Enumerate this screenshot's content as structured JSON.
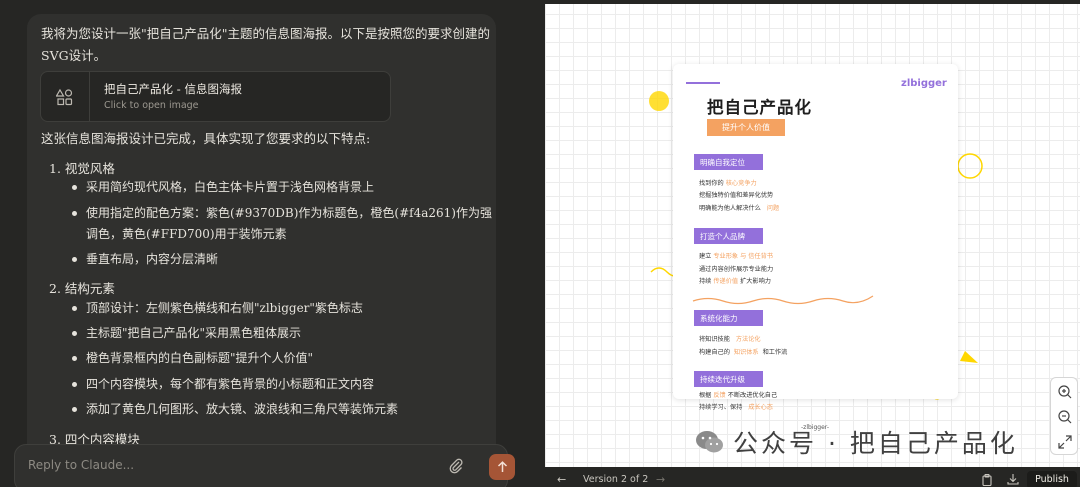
{
  "chat": {
    "intro": "我将为您设计一张\"把自己产品化\"主题的信息图海报。以下是按照您的要求创建的SVG设计。",
    "artifact": {
      "title": "把自己产品化 - 信息图海报",
      "subtitle": "Click to open image",
      "icon": "shapes-icon"
    },
    "summary": "这张信息图海报设计已完成，具体实现了您要求的以下特点:",
    "sections": [
      {
        "heading": "1. 视觉风格",
        "bullets": [
          "采用简约现代风格，白色主体卡片置于浅色网格背景上",
          "使用指定的配色方案：紫色(#9370DB)作为标题色，橙色(#f4a261)作为强调色，黄色(#FFD700)用于装饰元素",
          "垂直布局，内容分层清晰"
        ]
      },
      {
        "heading": "2. 结构元素",
        "bullets": [
          "顶部设计：左侧紫色横线和右侧\"zlbigger\"紫色标志",
          "主标题\"把自己产品化\"采用黑色粗体展示",
          "橙色背景框内的白色副标题\"提升个人价值\"",
          "四个内容模块，每个都有紫色背景的小标题和正文内容",
          "添加了黄色几何图形、放大镜、波浪线和三角尺等装饰元素"
        ]
      },
      {
        "heading": "3. 四个内容模块",
        "bullets": []
      }
    ],
    "reply_placeholder": "Reply to Claude..."
  },
  "preview": {
    "poster": {
      "brand": "zlbigger",
      "title": "把自己产品化",
      "subtitle": "提升个人价值",
      "modules": [
        {
          "heading": "明确自我定位",
          "lines": [
            [
              "找到你的",
              "核心竞争力",
              ""
            ],
            [
              "挖掘独特价值和差异化优势",
              "",
              ""
            ],
            [
              "明确能为他人解决什么",
              "问题",
              ""
            ]
          ]
        },
        {
          "heading": "打造个人品牌",
          "lines": [
            [
              "建立",
              "专业形象",
              "与 信任背书"
            ],
            [
              "通过内容创作展示专业能力",
              "",
              ""
            ],
            [
              "持续",
              "传递价值",
              "扩大影响力"
            ]
          ]
        },
        {
          "heading": "系统化能力",
          "lines": [
            [
              "将知识技能",
              "方法论化",
              ""
            ],
            [
              "构建自己的",
              "知识体系",
              "和工作流"
            ]
          ]
        },
        {
          "heading": "持续迭代升级",
          "lines": [
            [
              "根据",
              "反馈",
              "不断改进优化自己"
            ],
            [
              "持续学习、保持",
              "成长心态",
              ""
            ]
          ]
        }
      ],
      "footer": "-zlbigger-",
      "colors": {
        "purple": "#9370DB",
        "orange": "#f4a261",
        "yellow": "#FFD700"
      }
    },
    "watermark": "公众号 · 把自己产品化",
    "zoom_controls": [
      "zoom-in-icon",
      "zoom-out-icon",
      "fullscreen-icon"
    ],
    "bottom_bar": {
      "version": "Version 2 of 2",
      "prev": "←",
      "next": "→",
      "publish": "Publish"
    }
  }
}
